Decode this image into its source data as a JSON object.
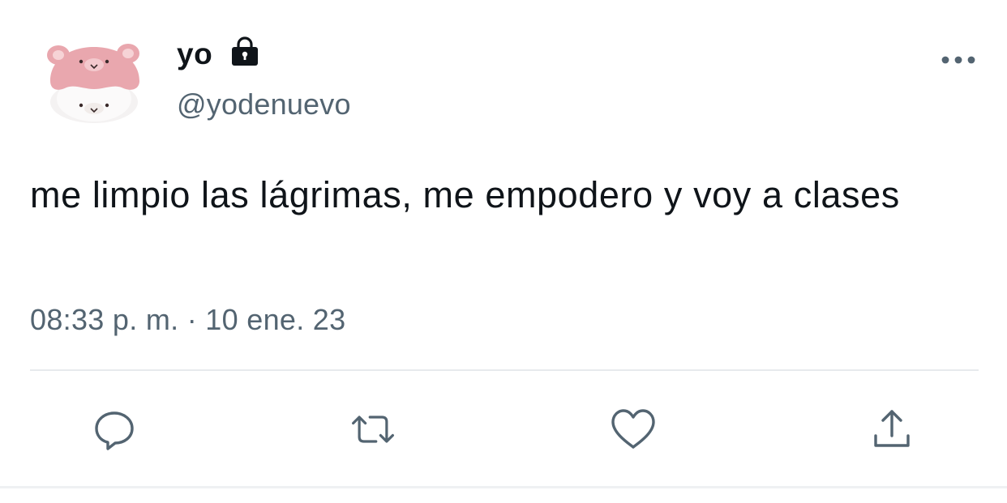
{
  "tweet": {
    "display_name": "yo",
    "handle": "@yodenuevo",
    "text": "me limpio las lágrimas, me empodero y voy a clases",
    "timestamp": "08:33 p. m. · 10 ene. 23",
    "protected_icon": "lock-icon",
    "avatar": "avatar-pink-bear-hat"
  },
  "actions": {
    "reply_icon": "reply-icon",
    "retweet_icon": "retweet-icon",
    "like_icon": "heart-icon",
    "share_icon": "share-icon",
    "more_icon": "more-icon"
  },
  "colors": {
    "text": "#0f1419",
    "secondary": "#536471",
    "icon": "#536471",
    "divider": "#e7eaed"
  }
}
